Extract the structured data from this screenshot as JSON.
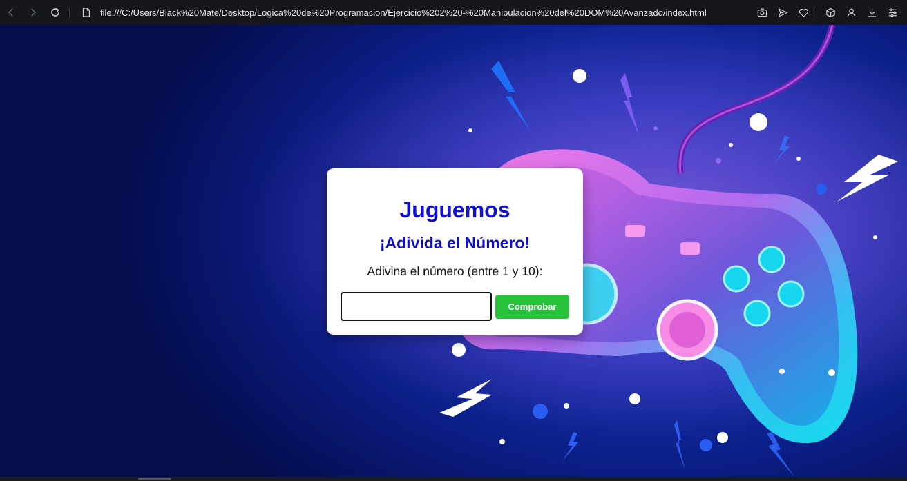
{
  "browser": {
    "url": "file:///C:/Users/Black%20Mate/Desktop/Logica%20de%20Programacion/Ejercicio%202%20-%20Manipulacion%20del%20DOM%20Avanzado/index.html",
    "nav_icons": [
      "back-arrow-icon",
      "forward-arrow-icon",
      "reload-icon"
    ],
    "tool_icons": [
      "camera-icon",
      "send-icon",
      "heart-icon",
      "cube-icon",
      "profile-icon",
      "download-icon",
      "menu-icon"
    ]
  },
  "game": {
    "title": "Juguemos",
    "subtitle": "¡Adivida el Número!",
    "instruction": "Adivina el número (entre 1 y 10):",
    "input_value": "",
    "input_placeholder": "",
    "button_label": "Comprobar"
  },
  "colors": {
    "heading": "#1010cc",
    "button": "#27c43b",
    "background": "#0b1e86"
  }
}
